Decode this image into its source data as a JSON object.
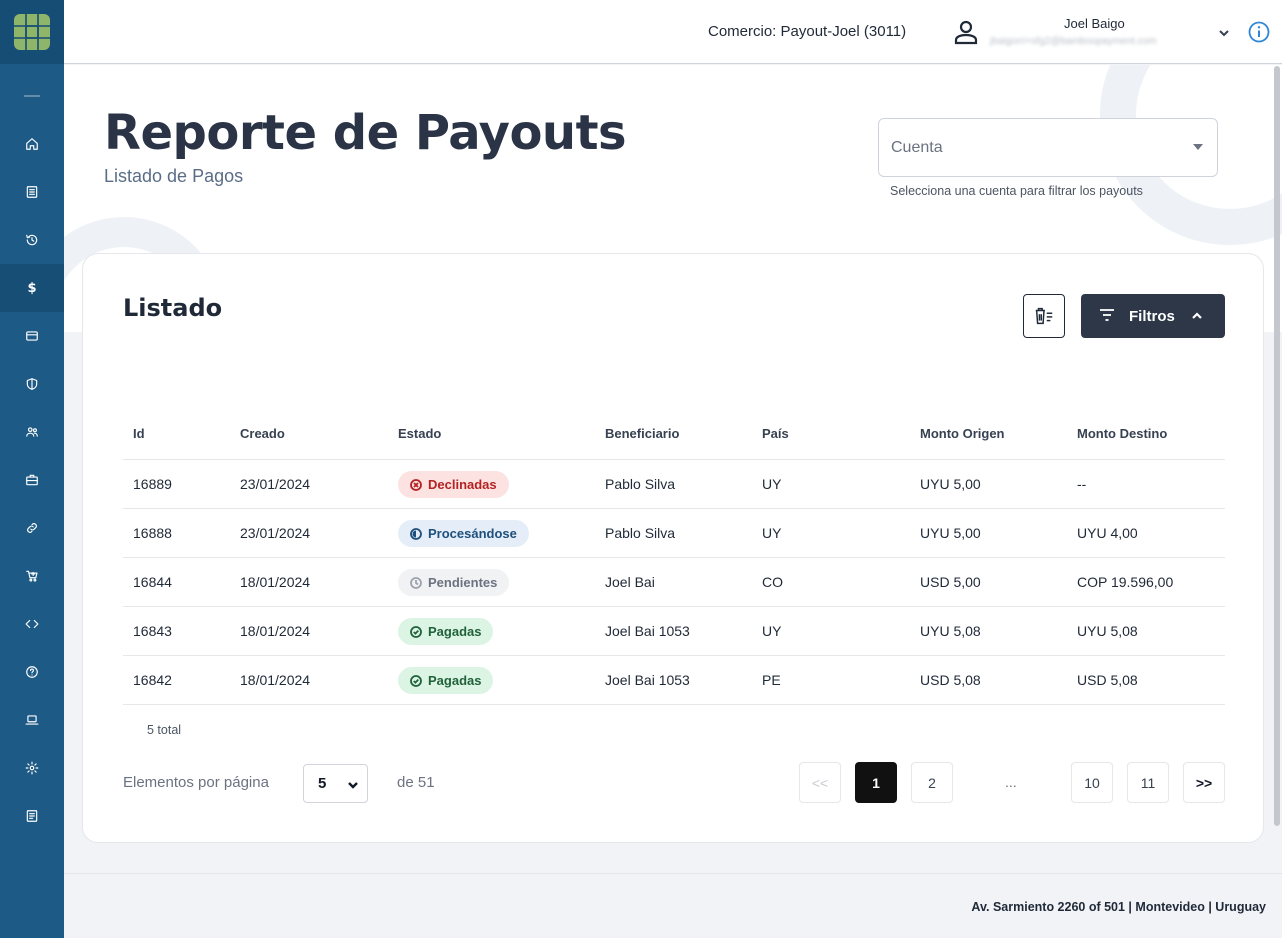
{
  "header": {
    "merchant": "Comercio: Payout-Joel (3011)",
    "user_name": "Joel Baigo",
    "user_email": "jbaigorri+sfg2@bamboopayment.com"
  },
  "page": {
    "title": "Reporte de Payouts",
    "subtitle": "Listado de Pagos",
    "account_placeholder": "Cuenta",
    "account_help": "Selecciona una cuenta para filtrar los payouts"
  },
  "card": {
    "title": "Listado",
    "filter_label": "Filtros"
  },
  "table": {
    "columns": [
      "Id",
      "Creado",
      "Estado",
      "Beneficiario",
      "País",
      "Monto Origen",
      "Monto Destino"
    ],
    "rows": [
      {
        "id": "16889",
        "created": "23/01/2024",
        "status": "Declinadas",
        "beneficiary": "Pablo Silva",
        "country": "UY",
        "amount_origin": "UYU 5,00",
        "amount_dest": "--"
      },
      {
        "id": "16888",
        "created": "23/01/2024",
        "status": "Procesándose",
        "beneficiary": "Pablo Silva",
        "country": "UY",
        "amount_origin": "UYU 5,00",
        "amount_dest": "UYU 4,00"
      },
      {
        "id": "16844",
        "created": "18/01/2024",
        "status": "Pendientes",
        "beneficiary": "Joel Bai",
        "country": "CO",
        "amount_origin": "USD 5,00",
        "amount_dest": "COP 19.596,00"
      },
      {
        "id": "16843",
        "created": "18/01/2024",
        "status": "Pagadas",
        "beneficiary": "Joel Bai 1053",
        "country": "UY",
        "amount_origin": "UYU 5,08",
        "amount_dest": "UYU 5,08"
      },
      {
        "id": "16842",
        "created": "18/01/2024",
        "status": "Pagadas",
        "beneficiary": "Joel Bai 1053",
        "country": "PE",
        "amount_origin": "USD 5,08",
        "amount_dest": "USD 5,08"
      }
    ],
    "total": "5 total"
  },
  "pagination": {
    "per_page_label": "Elementos por página",
    "per_page_value": "5",
    "of_total": "de 51",
    "first": "<<",
    "pages": [
      "1",
      "2"
    ],
    "ellipsis": "...",
    "last_pages": [
      "10",
      "11"
    ],
    "next": ">>"
  },
  "footer": {
    "address": "Av. Sarmiento 2260 of 501 | Montevideo | Uruguay"
  },
  "colors": {
    "sidebar": "#1e5a86",
    "primary_button": "#2d3748",
    "declined": "#b42323",
    "processing": "#1e4f7d",
    "pending": "#6b7280",
    "paid": "#20623a"
  },
  "sidebar_icons": [
    "home-icon",
    "report-icon",
    "history-icon",
    "dollar-icon",
    "card-icon",
    "shield-icon",
    "users-icon",
    "briefcase-icon",
    "link-icon",
    "cart-icon",
    "code-icon",
    "help-icon",
    "laptop-icon",
    "gear-icon",
    "document-icon"
  ]
}
